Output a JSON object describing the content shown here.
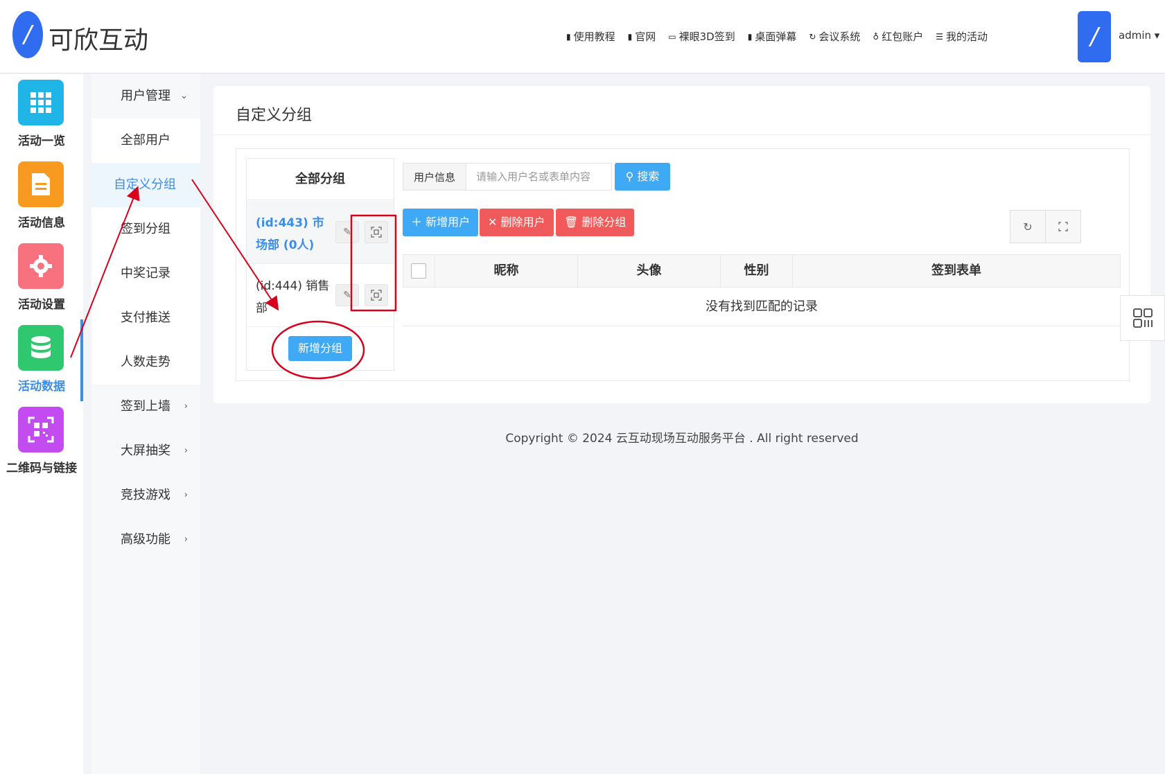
{
  "app": {
    "logo_glyph": "/",
    "logo_text": "可欣互动"
  },
  "topnav": [
    {
      "icon": "document-icon",
      "label": "使用教程"
    },
    {
      "icon": "document-icon",
      "label": "官网"
    },
    {
      "icon": "monitor-icon",
      "label": "裸眼3D签到"
    },
    {
      "icon": "document-icon",
      "label": "桌面弹幕"
    },
    {
      "icon": "refresh-icon",
      "label": "会议系统"
    },
    {
      "icon": "location-icon",
      "label": "红包账户"
    },
    {
      "icon": "list-icon",
      "label": "我的活动"
    }
  ],
  "user": {
    "avatar_glyph": "/",
    "name": "admin ▾"
  },
  "iconbar": [
    {
      "label": "活动一览",
      "icon": "grid-icon",
      "color": "#1fb5e6"
    },
    {
      "label": "活动信息",
      "icon": "document-icon",
      "color": "#f79a1f"
    },
    {
      "label": "活动设置",
      "icon": "gear-icon",
      "color": "#f7717e"
    },
    {
      "label": "活动数据",
      "icon": "database-icon",
      "color": "#2fc86e",
      "active": true
    },
    {
      "label": "二维码与链接",
      "icon": "qrcode-icon",
      "color": "#c24cf0"
    }
  ],
  "submenu": {
    "user_mgmt": "用户管理",
    "all_users": "全部用户",
    "custom_groups": "自定义分组",
    "checkin_groups": "签到分组",
    "prize_records": "中奖记录",
    "payment_push": "支付推送",
    "trend": "人数走势",
    "checkin_wall": "签到上墙",
    "lottery": "大屏抽奖",
    "games": "竞技游戏",
    "advanced": "高级功能"
  },
  "main": {
    "title": "自定义分组",
    "groups_header": "全部分组",
    "groups": [
      {
        "name": "(id:443) 市场部 (0人)",
        "active": true
      },
      {
        "name": "(id:444) 销售部",
        "active": false
      }
    ],
    "add_group_label": "新增分组",
    "search_label": "用户信息",
    "search_placeholder": "请输入用户名或表单内容",
    "search_button": "搜索",
    "add_user_label": "新增用户",
    "delete_user_label": "删除用户",
    "delete_group_label": "删除分组",
    "table_headers": [
      "昵称",
      "头像",
      "性别",
      "签到表单"
    ],
    "empty_text": "没有找到匹配的记录"
  },
  "footer": {
    "copyright": "Copyright © 2024 云互动现场互动服务平台 . All right reserved"
  },
  "colors": {
    "accent_blue": "#3fa9f5",
    "danger_red": "#f05a5a",
    "brand_blue": "#2f6cf0",
    "annotation_red": "#d9001b"
  }
}
